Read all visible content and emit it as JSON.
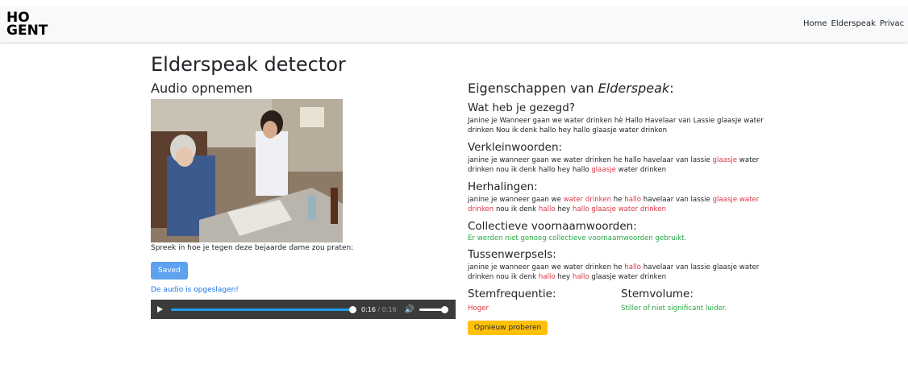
{
  "nav": {
    "logo_top": "HO",
    "logo_bottom": "GENT",
    "links": [
      "Home",
      "Elderspeak",
      "Privac"
    ]
  },
  "page": {
    "title": "Elderspeak detector"
  },
  "recorder": {
    "heading": "Audio opnemen",
    "prompt": "Spreek in hoe je tegen deze bejaarde dame zou praten:",
    "button_label": "Saved",
    "saved_message": "De audio is opgeslagen!",
    "player": {
      "current_time": "0:16",
      "separator": " / ",
      "duration": "0:16",
      "progress": 1.0,
      "volume": 1.0
    }
  },
  "results": {
    "heading_prefix": "Eigenschappen van ",
    "heading_em": "Elderspeak",
    "heading_suffix": ":",
    "said": {
      "heading": "Wat heb je gezegd?",
      "text": "Janine je Wanneer gaan we water drinken hè Hallo Havelaar van Lassie glaasje water drinken Nou ik denk hallo hey hallo glaasje water drinken"
    },
    "diminutives": {
      "heading": "Verkleinwoorden:",
      "segments": [
        {
          "t": "janine je wanneer gaan we water drinken he hallo havelaar van lassie ",
          "hl": false
        },
        {
          "t": "glaasje",
          "hl": true
        },
        {
          "t": " water drinken nou ik denk hallo hey hallo ",
          "hl": false
        },
        {
          "t": "glaasje",
          "hl": true
        },
        {
          "t": " water drinken",
          "hl": false
        }
      ]
    },
    "repetitions": {
      "heading": "Herhalingen:",
      "segments": [
        {
          "t": "janine je wanneer gaan we ",
          "hl": false
        },
        {
          "t": "water drinken",
          "hl": true
        },
        {
          "t": " he ",
          "hl": false
        },
        {
          "t": "hallo",
          "hl": true
        },
        {
          "t": " havelaar van lassie ",
          "hl": false
        },
        {
          "t": "glaasje water drinken",
          "hl": true
        },
        {
          "t": " nou ik denk ",
          "hl": false
        },
        {
          "t": "hallo",
          "hl": true
        },
        {
          "t": " hey ",
          "hl": false
        },
        {
          "t": "hallo glaasje water drinken",
          "hl": true
        }
      ]
    },
    "collective": {
      "heading": "Collectieve voornaamwoorden:",
      "text": "Er werden niet genoeg collectieve voornaamwoorden gebruikt."
    },
    "interjections": {
      "heading": "Tussenwerpsels:",
      "segments": [
        {
          "t": "janine je wanneer gaan we water drinken he ",
          "hl": false
        },
        {
          "t": "hallo",
          "hl": true
        },
        {
          "t": " havelaar van lassie glaasje water drinken nou ik denk ",
          "hl": false
        },
        {
          "t": "hallo",
          "hl": true
        },
        {
          "t": " hey ",
          "hl": false
        },
        {
          "t": "hallo",
          "hl": true
        },
        {
          "t": " glaasje water drinken",
          "hl": false
        }
      ]
    },
    "frequency": {
      "heading": "Stemfrequentie:",
      "value": "Hoger"
    },
    "volume": {
      "heading": "Stemvolume:",
      "value": "Stiller of niet significant luider."
    },
    "retry_label": "Opnieuw proberen"
  },
  "colors": {
    "highlight": "#dc3545",
    "success": "#28a745",
    "saved_button": "#5ea2ef",
    "retry_button": "#ffc107",
    "player_bg": "#3b3b3b",
    "progress": "#1ea0f0"
  }
}
